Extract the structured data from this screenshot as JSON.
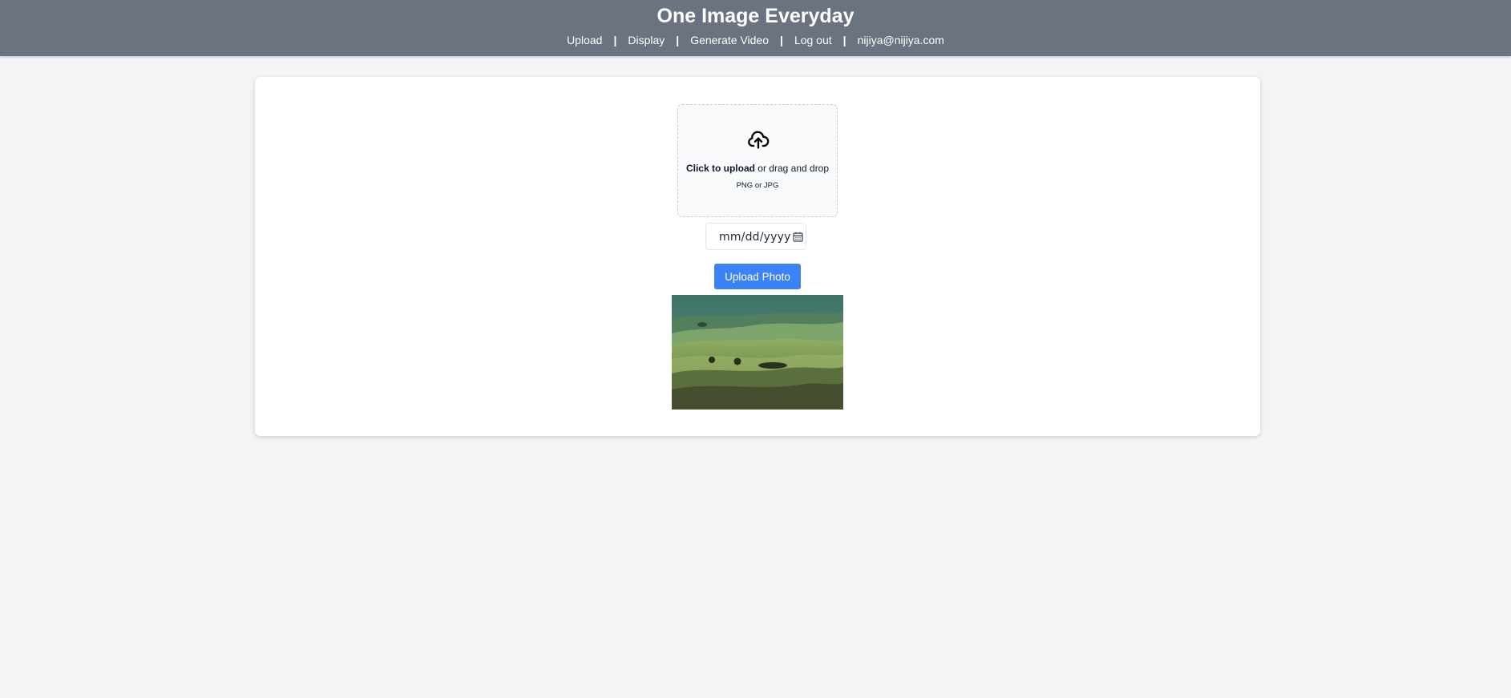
{
  "header": {
    "title": "One Image Everyday",
    "nav": {
      "upload": "Upload",
      "display": "Display",
      "generate_video": "Generate Video",
      "logout": "Log out",
      "user_email": "nijiya@nijiya.com",
      "separator": "|"
    }
  },
  "uploader": {
    "icon": "cloud-upload-icon",
    "click_text": "Click to upload",
    "drag_text": " or drag and drop",
    "formats": "PNG or JPG"
  },
  "date_field": {
    "placeholder": "mm/dd/yyyy",
    "icon": "calendar-icon"
  },
  "upload_button": {
    "label": "Upload Photo"
  },
  "colors": {
    "header_bg": "#6b7280",
    "page_bg": "#f3f4f6",
    "accent": "#3b82f6"
  }
}
